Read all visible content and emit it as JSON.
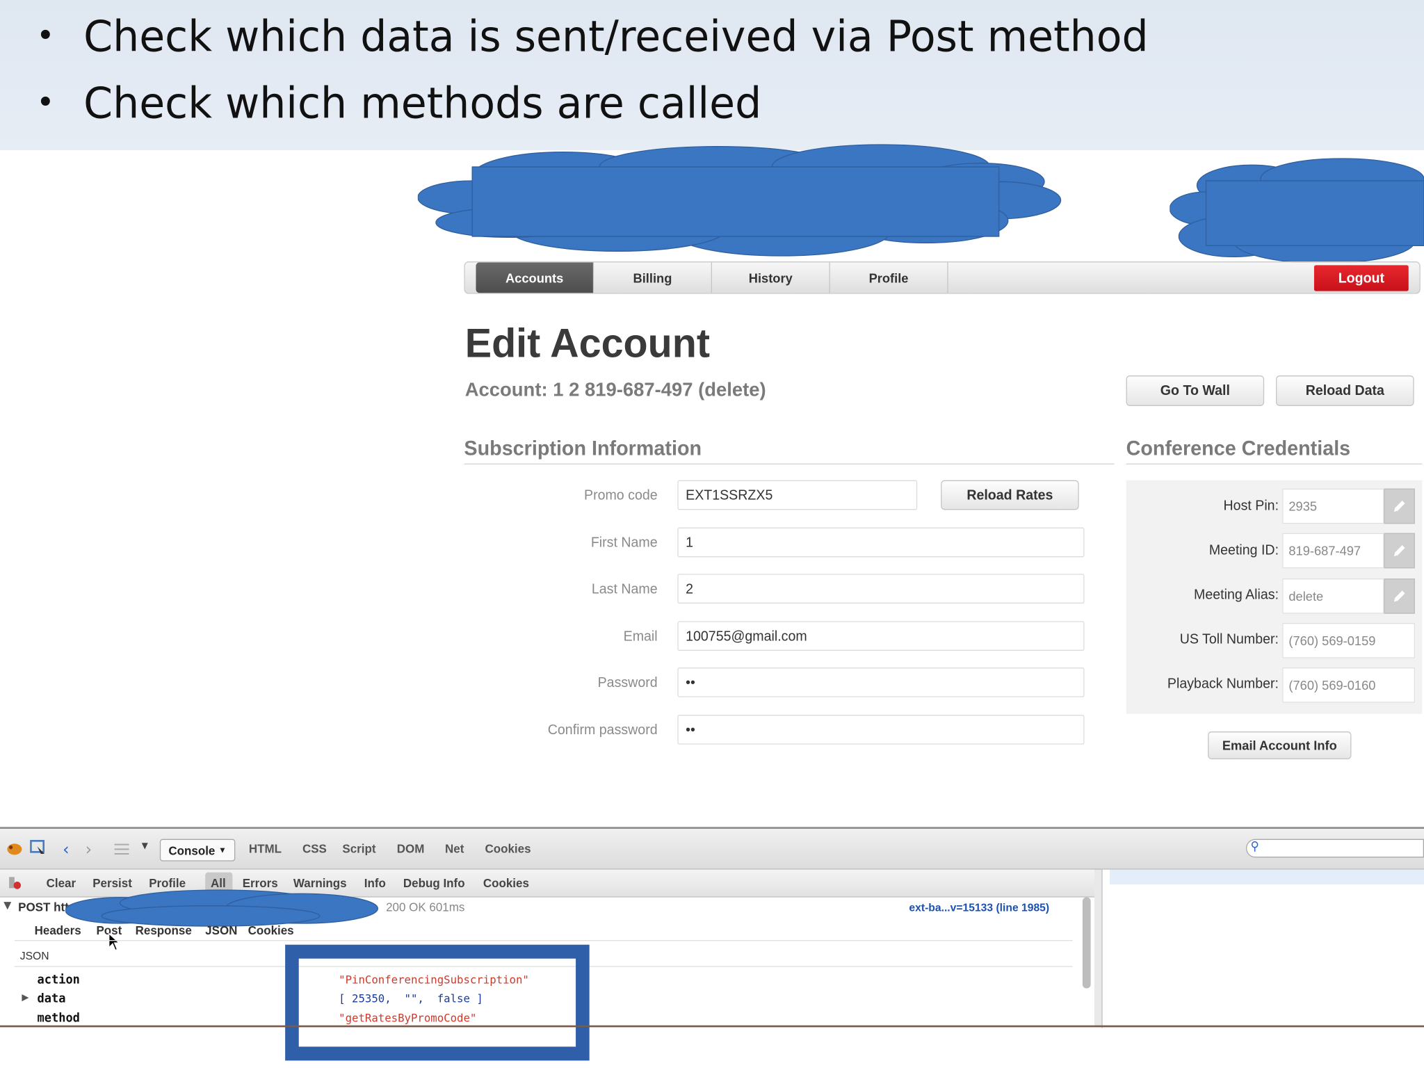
{
  "slide": {
    "bullets": [
      "Check which data is sent/received via Post method",
      "Check which methods are called"
    ]
  },
  "nav": {
    "tabs": [
      "Accounts",
      "Billing",
      "History",
      "Profile"
    ],
    "active_tab": "Accounts",
    "logout": "Logout"
  },
  "page": {
    "title": "Edit Account",
    "account_line": "Account: 1 2 819-687-497 (delete)",
    "go_to_wall": "Go To Wall",
    "reload_data": "Reload Data"
  },
  "subscription": {
    "heading": "Subscription Information",
    "reload_rates": "Reload Rates",
    "fields": [
      {
        "label": "Promo code",
        "value": "EXT1SSRZX5"
      },
      {
        "label": "First Name",
        "value": "1"
      },
      {
        "label": "Last Name",
        "value": "2"
      },
      {
        "label": "Email",
        "value": "100755@gmail.com"
      },
      {
        "label": "Password",
        "value": "••"
      },
      {
        "label": "Confirm password",
        "value": "••"
      }
    ]
  },
  "credentials": {
    "heading": "Conference Credentials",
    "rows": [
      {
        "label": "Host Pin:",
        "value": "2935",
        "editable": true
      },
      {
        "label": "Meeting ID:",
        "value": "819-687-497",
        "editable": true
      },
      {
        "label": "Meeting Alias:",
        "value": "delete",
        "editable": true
      },
      {
        "label": "US Toll Number:",
        "value": "(760) 569-0159",
        "editable": false
      },
      {
        "label": "Playback Number:",
        "value": "(760) 569-0160",
        "editable": false
      }
    ],
    "email_button": "Email Account Info"
  },
  "devtools": {
    "panel_tabs": [
      "HTML",
      "CSS",
      "Script",
      "DOM",
      "Net",
      "Cookies"
    ],
    "console_tab": "Console",
    "filters": [
      "Clear",
      "Persist",
      "Profile",
      "All",
      "Errors",
      "Warnings",
      "Info",
      "Debug Info",
      "Cookies"
    ],
    "request": {
      "method": "POST http",
      "status": "200 OK 601ms",
      "source": "ext-ba...v=15133 (line 1985)"
    },
    "request_tabs": [
      "Headers",
      "Post",
      "Response",
      "JSON",
      "Cookies"
    ],
    "json_label": "JSON",
    "json_rows": [
      {
        "key": "action",
        "value": "\"PinConferencingSubscription\""
      },
      {
        "key": "data",
        "value": "[ 25350,  \"\",  false ]"
      },
      {
        "key": "method",
        "value": "\"getRatesByPromoCode\""
      }
    ]
  },
  "colors": {
    "cloud": "#3b76c3",
    "logout": "#d8171f",
    "highlight_box": "#2e5fa8",
    "json_string": "#d03a2a",
    "json_number": "#1c3c9c",
    "source_link": "#1b52b0"
  }
}
